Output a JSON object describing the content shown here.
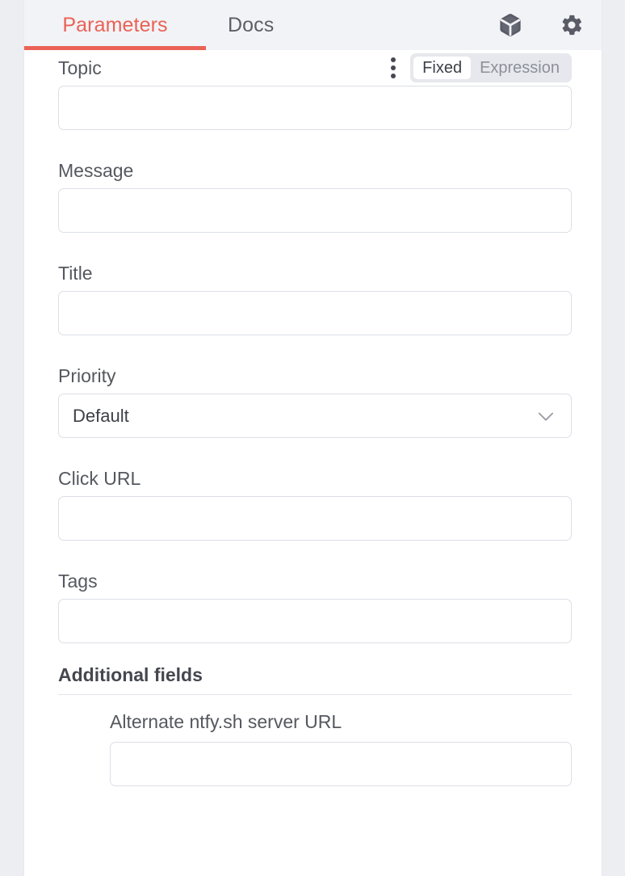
{
  "panel": {
    "tabs": [
      {
        "label": "Parameters",
        "active": true
      },
      {
        "label": "Docs",
        "active": false
      }
    ],
    "actions": [
      {
        "name": "cube-icon",
        "title": "Node"
      },
      {
        "name": "gear-icon",
        "title": "Settings"
      }
    ]
  },
  "parameter_toggle": {
    "fixed_label": "Fixed",
    "expression_label": "Expression",
    "selected": "Fixed"
  },
  "fields": {
    "topic": {
      "label": "Topic",
      "value": "",
      "placeholder": ""
    },
    "message": {
      "label": "Message",
      "value": "",
      "placeholder": ""
    },
    "title": {
      "label": "Title",
      "value": "",
      "placeholder": ""
    },
    "priority": {
      "label": "Priority",
      "value": "Default",
      "options": [
        "Default"
      ]
    },
    "click_url": {
      "label": "Click URL",
      "value": "",
      "placeholder": ""
    },
    "tags": {
      "label": "Tags",
      "value": "",
      "placeholder": ""
    }
  },
  "additional": {
    "section_title": "Additional fields",
    "alternate_server": {
      "label": "Alternate ntfy.sh server URL",
      "value": "",
      "placeholder": ""
    }
  },
  "colors": {
    "accent": "#ea6256",
    "header_bg": "#f2f3f6",
    "border": "#dcdfe6",
    "text": "#55585f",
    "muted": "#8d9097",
    "page_bg": "#eceef2"
  }
}
